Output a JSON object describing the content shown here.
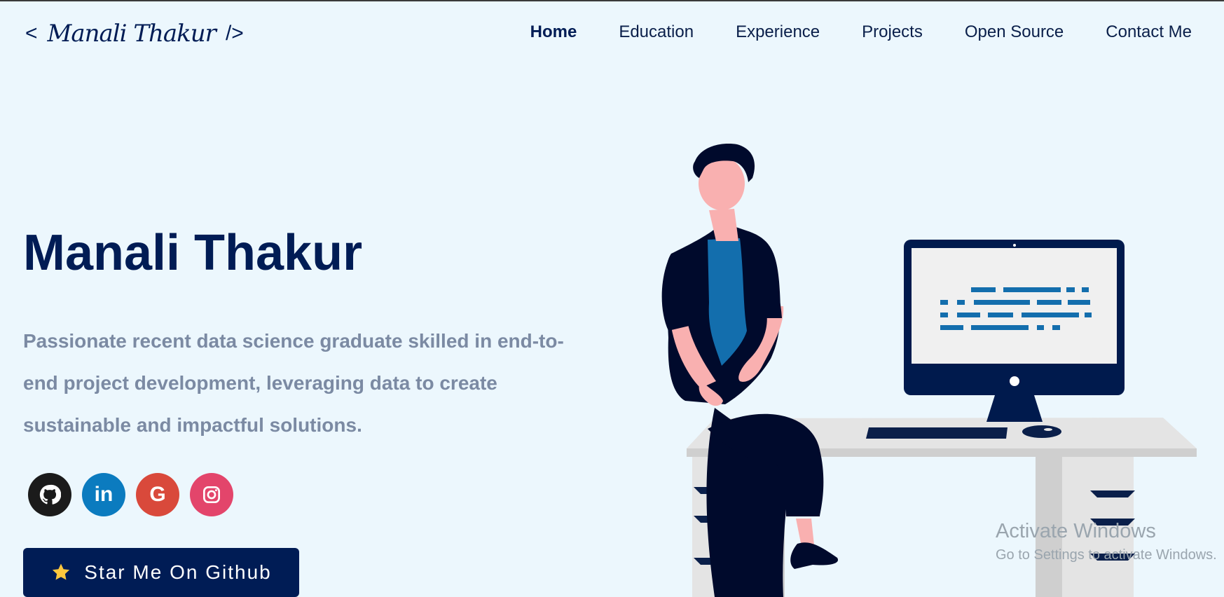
{
  "header": {
    "logo": {
      "open": "<",
      "signature": "Manali Thakur",
      "close": "/>"
    },
    "nav": [
      {
        "label": "Home",
        "active": true
      },
      {
        "label": "Education"
      },
      {
        "label": "Experience"
      },
      {
        "label": "Projects"
      },
      {
        "label": "Open Source"
      },
      {
        "label": "Contact Me"
      }
    ]
  },
  "hero": {
    "name": "Manali Thakur",
    "subtitle": "Passionate recent data science graduate skilled in end-to-end project development, leveraging data to create sustainable and impactful solutions.",
    "socials": [
      {
        "icon": "github-icon",
        "color": "#1b1b1b"
      },
      {
        "icon": "linkedin-icon",
        "color": "#0b7bbf",
        "glyph": "in"
      },
      {
        "icon": "google-icon",
        "color": "#d9493b",
        "glyph": "G"
      },
      {
        "icon": "instagram-icon",
        "color": "#e3456b"
      }
    ],
    "github_button": {
      "icon": "star-icon",
      "label": "Star Me On Github"
    }
  },
  "system_overlay": {
    "title": "Activate Windows",
    "message": "Go to Settings to activate Windows."
  },
  "colors": {
    "background": "#ecf7fd",
    "primary": "#001c55",
    "subtitle": "#7b8aa3",
    "accent_blue": "#136ead"
  }
}
